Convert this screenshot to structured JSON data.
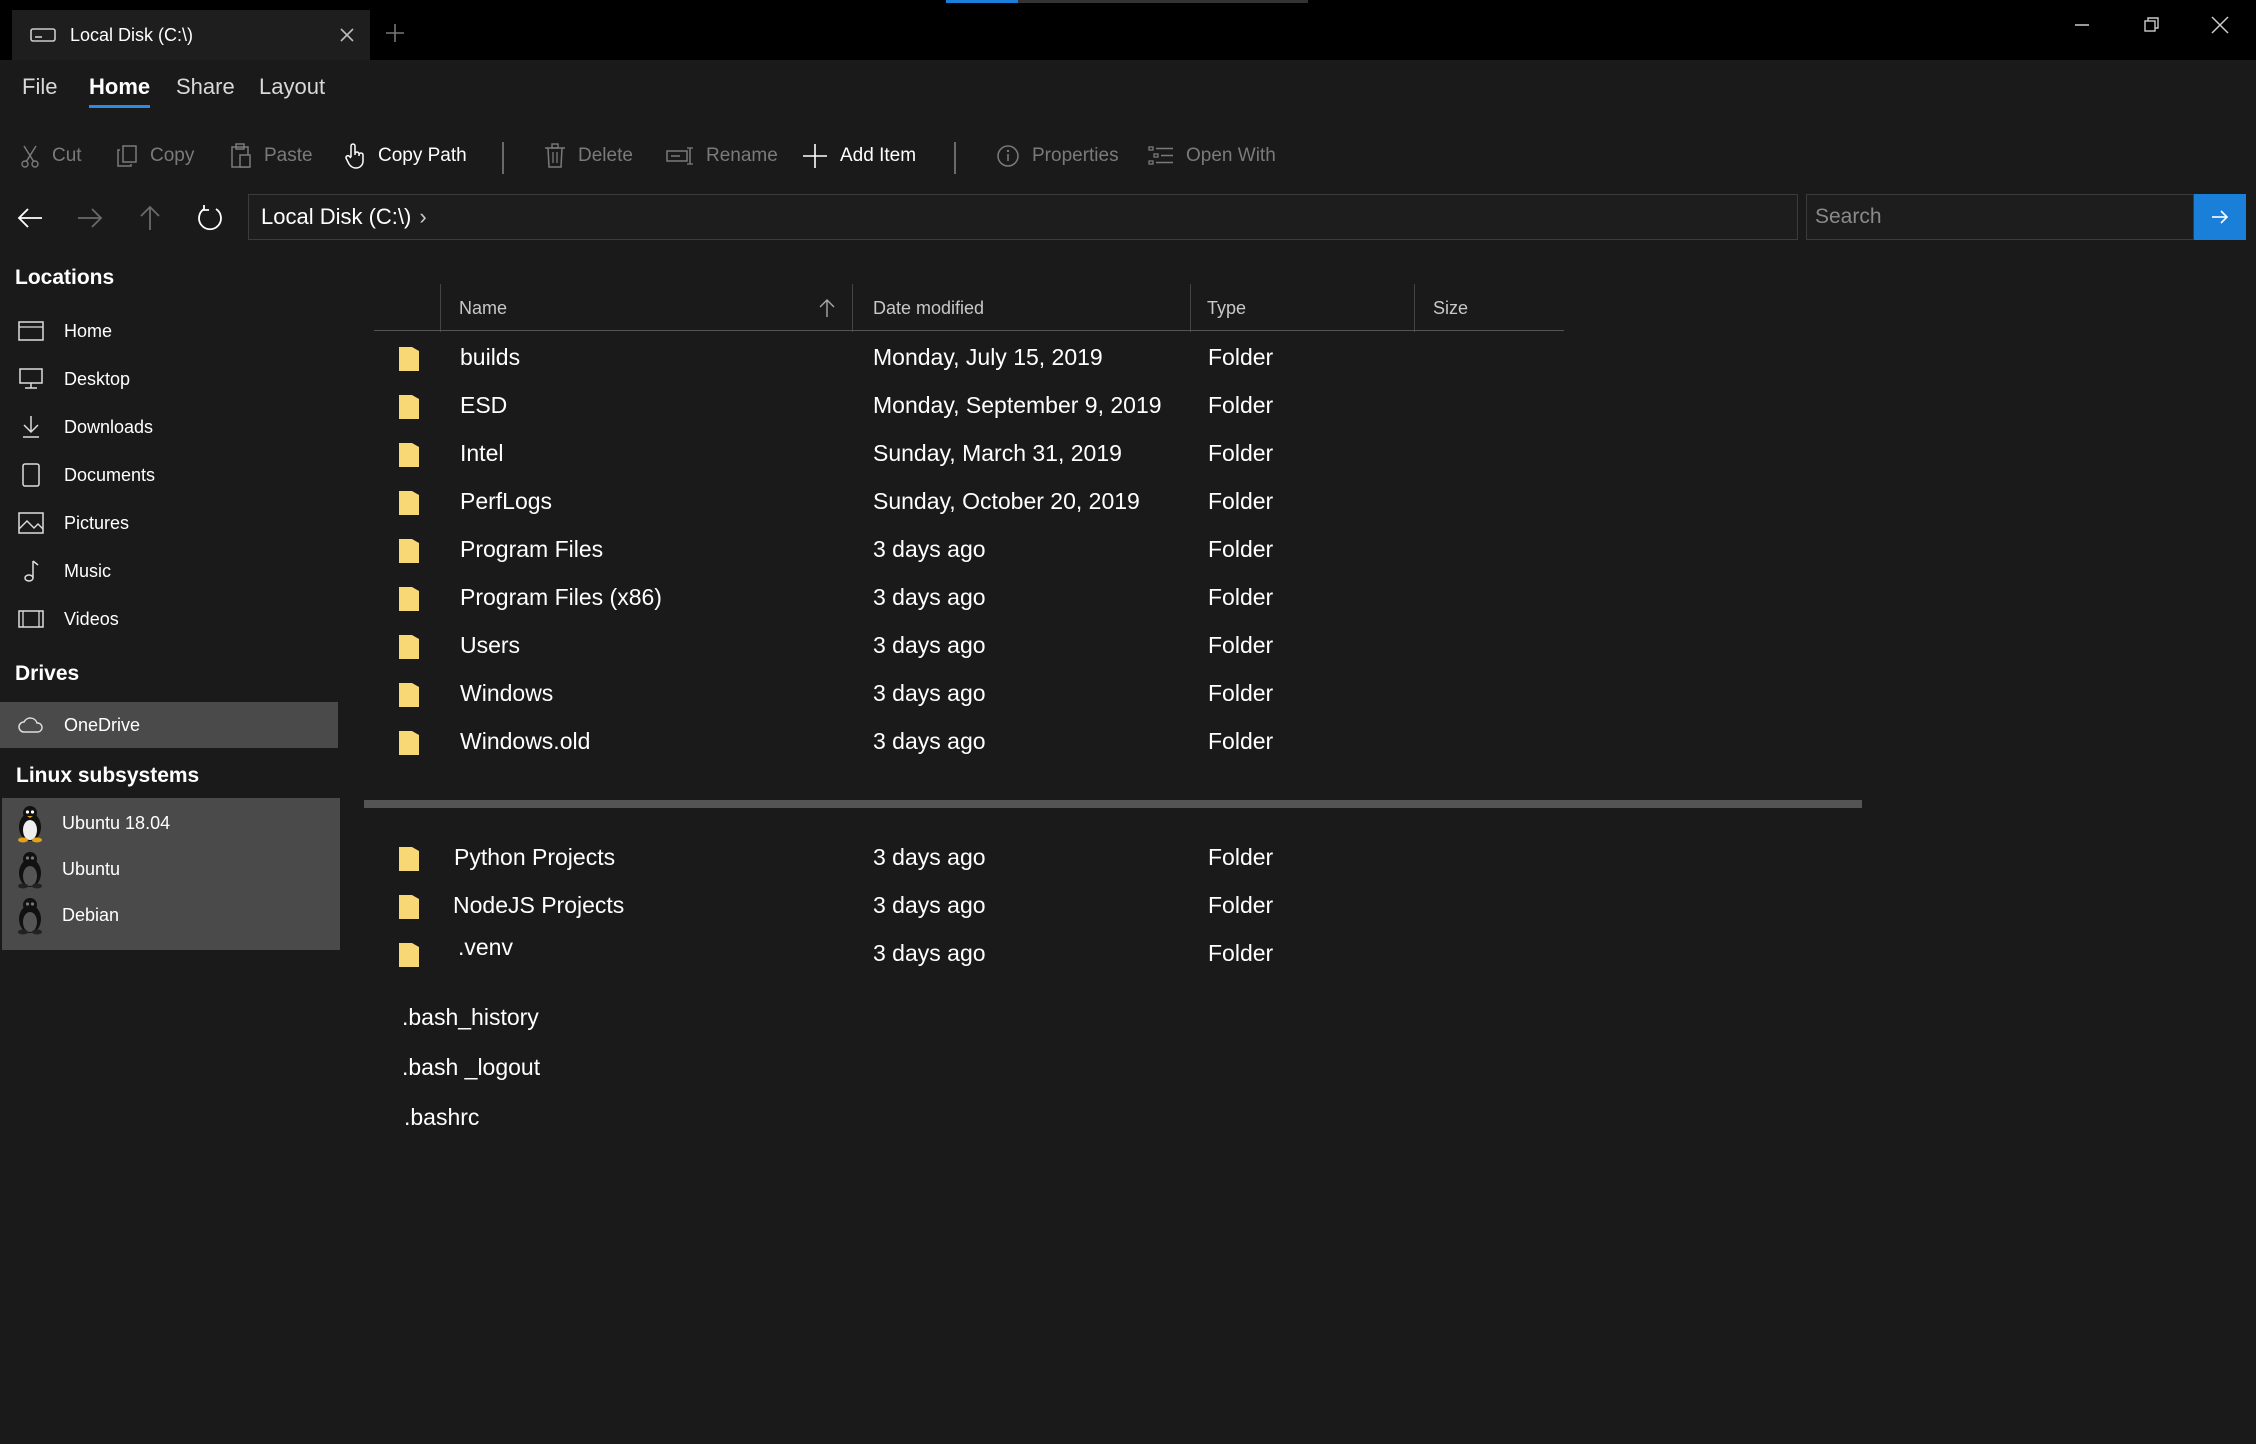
{
  "titlebar": {
    "tab_title": "Local Disk (C:\\)"
  },
  "menu": {
    "tabs": [
      "File",
      "Home",
      "Share",
      "Layout"
    ],
    "active": "Home"
  },
  "toolbar": {
    "cut": "Cut",
    "copy": "Copy",
    "paste": "Paste",
    "copy_path": "Copy Path",
    "delete": "Delete",
    "rename": "Rename",
    "add_item": "Add Item",
    "properties": "Properties",
    "open_with": "Open With"
  },
  "navbar": {
    "path": "Local Disk (C:\\)",
    "search_placeholder": "Search"
  },
  "sidebar": {
    "locations_heading": "Locations",
    "locations": [
      {
        "label": "Home",
        "icon": "home-icon"
      },
      {
        "label": "Desktop",
        "icon": "desktop-icon"
      },
      {
        "label": "Downloads",
        "icon": "downloads-icon"
      },
      {
        "label": "Documents",
        "icon": "documents-icon"
      },
      {
        "label": "Pictures",
        "icon": "pictures-icon"
      },
      {
        "label": "Music",
        "icon": "music-icon"
      },
      {
        "label": "Videos",
        "icon": "videos-icon"
      }
    ],
    "drives_heading": "Drives",
    "drives": [
      {
        "label": "OneDrive",
        "icon": "cloud-icon"
      }
    ],
    "linux_heading": "Linux subsystems",
    "linux": [
      {
        "label": "Ubuntu 18.04",
        "icon": "tux-icon"
      },
      {
        "label": "Ubuntu",
        "icon": "tux-icon"
      },
      {
        "label": "Debian",
        "icon": "tux-icon"
      }
    ]
  },
  "filelist": {
    "columns": [
      "Name",
      "Date modified",
      "Type",
      "Size"
    ],
    "sort_column": "Name",
    "rows": [
      {
        "name": "builds",
        "date": "Monday, July 15, 2019",
        "type": "Folder"
      },
      {
        "name": "ESD",
        "date": "Monday, September 9, 2019",
        "type": "Folder"
      },
      {
        "name": "Intel",
        "date": "Sunday, March 31, 2019",
        "type": "Folder"
      },
      {
        "name": "PerfLogs",
        "date": "Sunday, October 20, 2019",
        "type": "Folder"
      },
      {
        "name": "Program Files",
        "date": "3 days ago",
        "type": "Folder"
      },
      {
        "name": "Program Files (x86)",
        "date": "3 days ago",
        "type": "Folder"
      },
      {
        "name": "Users",
        "date": "3 days ago",
        "type": "Folder"
      },
      {
        "name": "Windows",
        "date": "3 days ago",
        "type": "Folder"
      },
      {
        "name": "Windows.old",
        "date": "3 days ago",
        "type": "Folder"
      }
    ],
    "rows2": [
      {
        "name": "Python Projects",
        "date": "3 days ago",
        "type": "Folder"
      },
      {
        "name": "NodeJS Projects",
        "date": "3 days ago",
        "type": "Folder"
      },
      {
        "name": ".venv",
        "date": "3 days ago",
        "type": "Folder"
      }
    ],
    "plain_files": [
      ".bash_history",
      ".bash _logout",
      ".bashrc"
    ]
  },
  "colors": {
    "accent": "#1a7fd9",
    "folder": "#f8d775",
    "background": "#1a1a1a"
  }
}
